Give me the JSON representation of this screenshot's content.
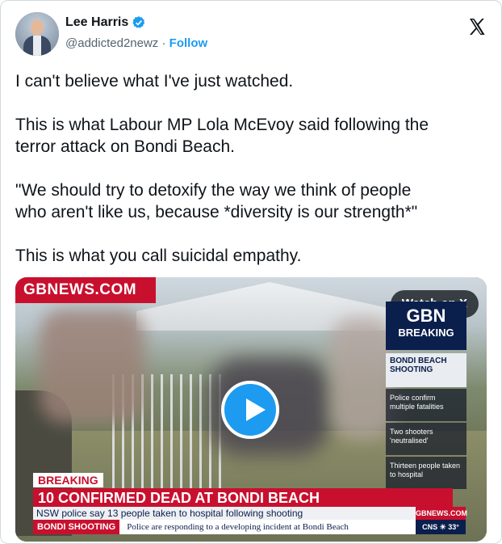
{
  "author": {
    "name": "Lee Harris",
    "handle": "@addicted2newz",
    "separator": "·",
    "follow_label": "Follow"
  },
  "tweet": {
    "paragraphs": [
      "I can't believe what I've just watched.",
      "This is what Labour MP Lola McEvoy said following the\nterror attack on Bondi Beach.",
      "\"We should try to detoxify the way we think of people\nwho aren't like us, because *diversity is our strength*\"",
      "This is what you call suicidal empathy."
    ]
  },
  "video": {
    "brand": "GBNEWS.COM",
    "watch_label": "Watch on X",
    "side_logo_top": "GBN",
    "side_logo_bottom": "BREAKING",
    "side_card": "BONDI BEACH SHOOTING",
    "side_items": [
      "Police confirm multiple fatalities",
      "Two shooters 'neutralised'",
      "Thirteen people taken to hospital"
    ],
    "breaking_tag": "BREAKING",
    "headline": "10 CONFIRMED DEAD AT BONDI BEACH",
    "ticker": "NSW police say 13 people taken to hospital following shooting",
    "strip_tag": "BONDI SHOOTING",
    "strip_text": "Police are responding to a developing incident at Bondi Beach",
    "site": "GBNEWS.COM",
    "weather": "CNS ☀ 33°"
  },
  "colors": {
    "accent": "#1d9bf0",
    "gbnews_red": "#c8102e",
    "gbnews_navy": "#0b1f4d"
  },
  "icons": {
    "verified": "verified-badge-icon",
    "x_logo": "x-logo-icon",
    "play": "play-icon"
  }
}
